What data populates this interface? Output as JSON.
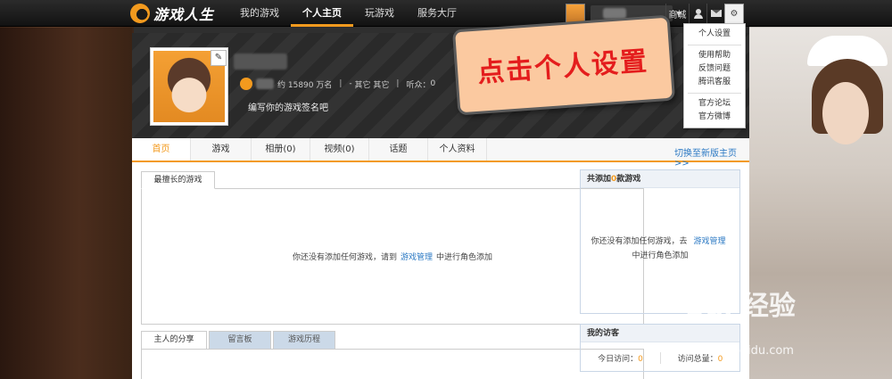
{
  "topbar": {
    "logo_text": "游戏人生",
    "nav": [
      "我的游戏",
      "个人主页",
      "玩游戏",
      "服务大厅"
    ],
    "active_nav": "个人主页",
    "shop_label": "商城"
  },
  "dropdown": {
    "items_group1": [
      "个人设置"
    ],
    "items_group2": [
      "使用帮助",
      "反馈问题",
      "腾讯客服"
    ],
    "items_group3": [
      "官方论坛",
      "官方微博"
    ]
  },
  "callout": {
    "text": "点击个人设置"
  },
  "profile": {
    "rank_text": "约 15890 万名",
    "location": "其它 其它",
    "listeners_label": "听众：",
    "listeners_count": "0",
    "signature": "编写你的游戏签名吧"
  },
  "tabs": [
    "首页",
    "游戏",
    "相册(0)",
    "视频(0)",
    "话题",
    "个人资料"
  ],
  "switch_link": "切换至新版主页>>",
  "left_panel": {
    "tab": "最擅长的游戏",
    "msg_before": "你还没有添加任何游戏，请到",
    "msg_link": "游戏管理",
    "msg_after": "中进行角色添加"
  },
  "right_panel": {
    "title_before": "共添加",
    "title_count": "0",
    "title_after": "款游戏",
    "msg_before": "你还没有添加任何游戏，去",
    "msg_link": "游戏管理",
    "msg_after": "中进行角色添加"
  },
  "bottom_tabs": [
    "主人的分享",
    "留言板",
    "游戏历程"
  ],
  "visitors": {
    "title": "我的访客",
    "today_label": "今日访问：",
    "today_count": "0",
    "total_label": "访问总量：",
    "total_count": "0"
  },
  "watermark": {
    "main": "Bai 经验",
    "sub": "jingyan.baidu.com"
  },
  "icons": [
    "logo-icon",
    "user-icon",
    "mail-icon",
    "gear-icon",
    "pencil-icon",
    "caret-down-icon",
    "rank-badge-icon"
  ],
  "colors": {
    "accent": "#f39a1e",
    "link": "#2a78c3",
    "callout_bg": "#fbc9a0",
    "callout_text": "#e41d1d"
  }
}
